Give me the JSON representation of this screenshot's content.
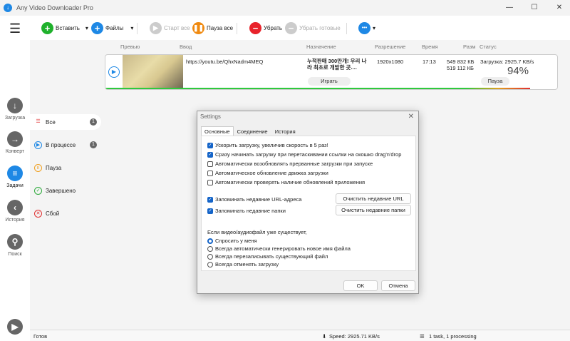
{
  "app": {
    "title": "Any Video Downloader Pro",
    "minimize": "—",
    "maximize": "☐",
    "close": "✕"
  },
  "toolbar": {
    "menu": "☰",
    "paste": "Вставить",
    "files": "Файлы",
    "start_all": "Старт все",
    "pause_all": "Пауза все",
    "remove": "Убрать",
    "remove_done": "Убрать готовые",
    "more": "•••",
    "arrow": "▾"
  },
  "rail": [
    {
      "label": "Загрузка",
      "icon": "↓"
    },
    {
      "label": "Конверт",
      "icon": "→"
    },
    {
      "label": "Задачи",
      "icon": "≡"
    },
    {
      "label": "История",
      "icon": "‹"
    },
    {
      "label": "Поиск",
      "icon": "⚲"
    }
  ],
  "categories": [
    {
      "label": "Все",
      "count": "1",
      "color": "#555"
    },
    {
      "label": "В процессе",
      "count": "1",
      "color": "#1e88e5"
    },
    {
      "label": "Пауза",
      "color": "#f0a020"
    },
    {
      "label": "Завершено",
      "color": "#2eaa3c"
    },
    {
      "label": "Сбой",
      "color": "#e03030"
    }
  ],
  "columns": {
    "preview": "Превью",
    "input": "Ввод",
    "dest": "Назначение",
    "res": "Разрешение",
    "time": "Время",
    "size": "Разм",
    "status": "Статус"
  },
  "task": {
    "url": "https://youtu.be/QhxNadm4MEQ",
    "title": "누적판매 300만개! 우리 나라 최초로 개발한 곳....",
    "resolution": "1920x1080",
    "time": "17:13",
    "size_total": "549 832 КБ",
    "size_done": "519 112 КБ",
    "status": "Загрузка: 2925.7 KB/s",
    "percent": "94%",
    "progress": 0.94,
    "play": "Играть",
    "pause": "Пауза"
  },
  "dialog": {
    "title": "Settings",
    "tabs": [
      "Основные",
      "Соединение",
      "История"
    ],
    "options": [
      {
        "label": "Ускорить загрузку, увеличив скорость в 5 раз!",
        "checked": true
      },
      {
        "label": "Сразу начинать загрузку при перетаскивании ссылки на окошко drag'n'drop",
        "checked": true
      },
      {
        "label": "Автоматически возобновлять прерванные загрузки при запуске",
        "checked": false
      },
      {
        "label": "Автоматическое обновление движка загрузки",
        "checked": false
      },
      {
        "label": "Автоматически проверять наличие обновлений приложения",
        "checked": false
      }
    ],
    "remember_urls": "Запоминать недавние URL-адреса",
    "remember_folders": "Запоминать недавние папки",
    "clear_urls": "Очистить недавние URL",
    "clear_folders": "Очистить недавние папки",
    "exists_label": "Если видео/аудиофайл уже существует,",
    "radios": [
      "Спросить у меня",
      "Всегда автоматически генерировать новое имя файла",
      "Всегда перезаписывать существующий файл",
      "Всегда отменять загрузку"
    ],
    "ok": "OK",
    "cancel": "Отмена",
    "check": "✓"
  },
  "statusbar": {
    "ready": "Готов",
    "speed": "Speed: 2925.71 KB/s",
    "tasks": "1 task, 1 processing"
  }
}
